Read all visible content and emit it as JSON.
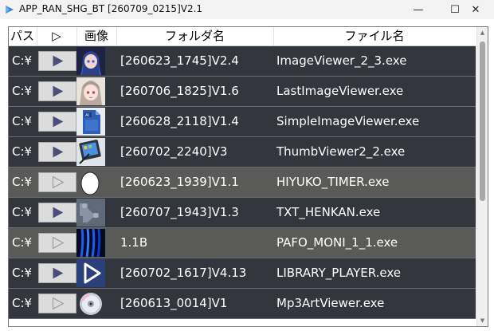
{
  "window": {
    "title": "APP_RAN_SHG_BT [260709_0215]V2.1",
    "minimize_glyph": "—",
    "maximize_glyph": "☐",
    "close_glyph": "✕"
  },
  "table": {
    "headers": {
      "path": "パス",
      "play": "▷",
      "image": "画像",
      "folder": "フォルダ名",
      "file": "ファイル名"
    },
    "rows": [
      {
        "path": "C:¥",
        "play_enabled": true,
        "icon": "anime-girl-blue-icon",
        "folder": "[260623_1745]V2.4",
        "file": "ImageViewer_2_3.exe"
      },
      {
        "path": "C:¥",
        "play_enabled": true,
        "icon": "anime-girl-gray-icon",
        "folder": "[260706_1825]V1.6",
        "file": "LastImageViewer.exe"
      },
      {
        "path": "C:¥",
        "play_enabled": true,
        "icon": "ai-document-icon",
        "folder": "[260628_2118]V1.4",
        "file": "SimpleImageViewer.exe"
      },
      {
        "path": "C:¥",
        "play_enabled": true,
        "icon": "tablet-pen-icon",
        "folder": "[260702_2240]V3",
        "file": "ThumbViewer2_2.exe"
      },
      {
        "path": "C:¥",
        "play_enabled": false,
        "icon": "egg-icon",
        "folder": "[260623_1939]V1.1",
        "file": "HIYUKO_TIMER.exe"
      },
      {
        "path": "C:¥",
        "play_enabled": true,
        "icon": "text-convert-icon",
        "folder": "[260707_1943]V1.3",
        "file": "TXT_HENKAN.exe"
      },
      {
        "path": "C:¥",
        "play_enabled": false,
        "icon": "blue-waves-icon",
        "folder": "1.1B",
        "file": "PAFO_MONI_1_1.exe"
      },
      {
        "path": "C:¥",
        "play_enabled": true,
        "icon": "play-triangle-icon",
        "folder": "[260702_1617]V4.13",
        "file": "LIBRARY_PLAYER.exe"
      },
      {
        "path": "C:¥",
        "play_enabled": false,
        "icon": "cd-disc-icon",
        "folder": "[260613_0014]V1",
        "file": "Mp3ArtViewer.exe"
      }
    ]
  },
  "colors": {
    "row_dark": "#33373d",
    "row_gray": "#5a5a58",
    "play_enabled": "#4a4f7a",
    "play_disabled": "#9a9a9a"
  }
}
